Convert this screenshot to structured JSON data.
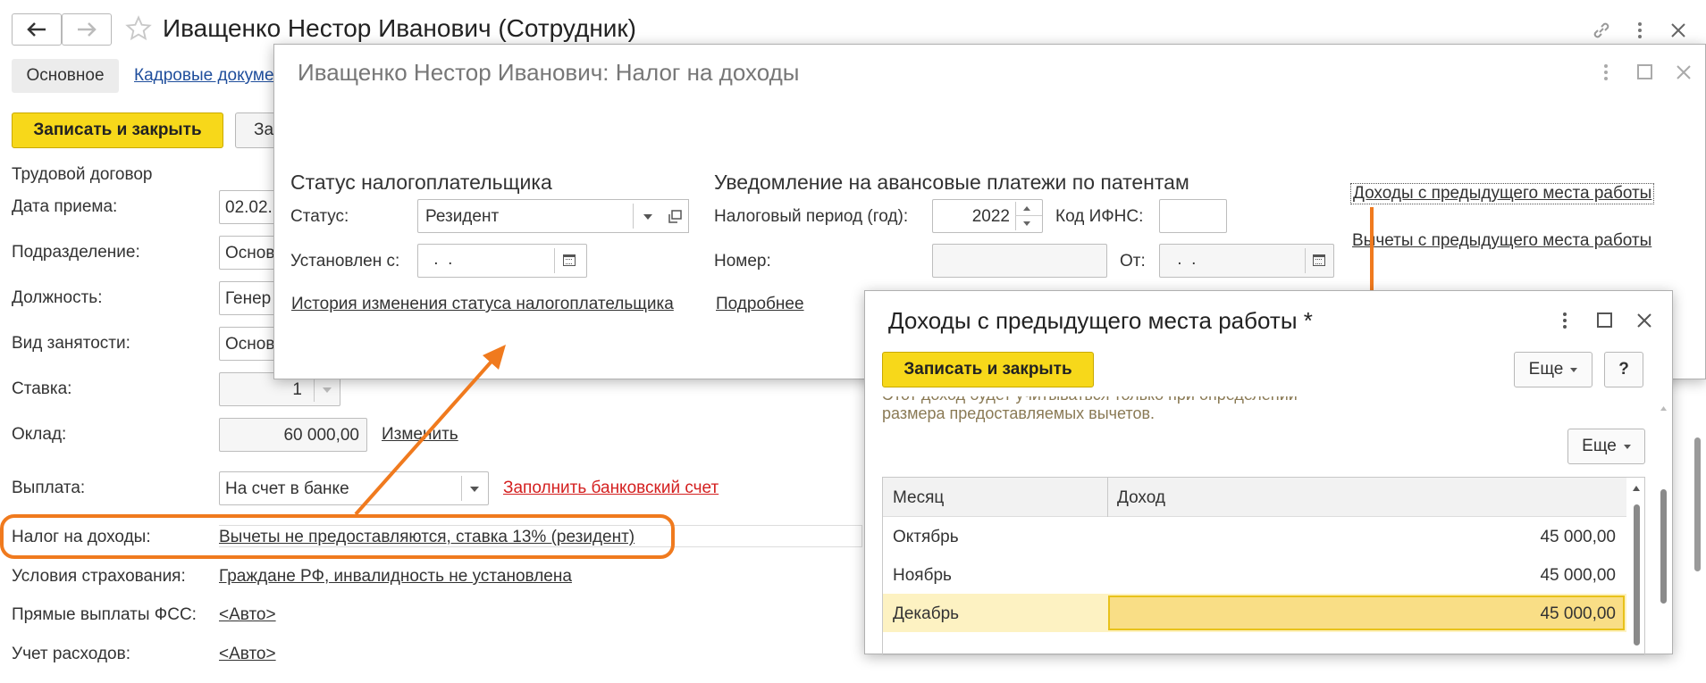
{
  "main": {
    "title": "Иващенко Нестор Иванович (Сотрудник)",
    "tabs": {
      "main_tab": "Основное",
      "hr_docs": "Кадровые докуме"
    },
    "save_close": "Записать и закрыть",
    "save_partial": "За",
    "section_contract": "Трудовой договор",
    "rows": {
      "hire_date": {
        "label": "Дата приема:",
        "value": "02.02."
      },
      "department": {
        "label": "Подразделение:",
        "value": "Основ"
      },
      "position": {
        "label": "Должность:",
        "value": "Генер"
      },
      "employment": {
        "label": "Вид занятости:",
        "value": "Основ"
      },
      "rate": {
        "label": "Ставка:",
        "value": "1"
      },
      "salary": {
        "label": "Оклад:",
        "value": "60 000,00",
        "link": "Изменить"
      },
      "payment": {
        "label": "Выплата:",
        "value": "На счет в банке",
        "link": "Заполнить банковский счет"
      },
      "income_tax": {
        "label": "Налог на доходы:",
        "link": "Вычеты не предоставляются, ставка 13% (резидент)"
      },
      "insurance": {
        "label": "Условия страхования:",
        "link": "Граждане РФ, инвалидность не установлена"
      },
      "fss": {
        "label": "Прямые выплаты ФСС:",
        "link": "<Авто>"
      },
      "expenses": {
        "label": "Учет расходов:",
        "link": "<Авто>"
      }
    }
  },
  "tax_window": {
    "title": "Иващенко Нестор Иванович: Налог на доходы",
    "status_section": "Статус налогоплательщика",
    "status_label": "Статус:",
    "status_value": "Резидент",
    "set_from_label": "Установлен с:",
    "set_from_value": " .  .",
    "history_link": "История изменения статуса налогоплательщика",
    "patent_section": "Уведомление на авансовые платежи по патентам",
    "period_label": "Налоговый период (год):",
    "period_value": "2022",
    "ifns_label": "Код ИФНС:",
    "number_label": "Номер:",
    "from_label": "От:",
    "from_value": " .  .",
    "more_link": "Подробнее",
    "prev_income_link": "Доходы с предыдущего места работы",
    "prev_deductions_link": "Вычеты с предыдущего места работы"
  },
  "income_window": {
    "title": "Доходы с предыдущего места работы *",
    "save_close": "Записать и закрыть",
    "more": "Еще",
    "help": "?",
    "note_line1": "Этот доход будет учитываться только при определении",
    "note_line2": "размера предоставляемых вычетов.",
    "table": {
      "headers": [
        "Месяц",
        "Доход"
      ],
      "rows": [
        {
          "month": "Октябрь",
          "income": "45 000,00"
        },
        {
          "month": "Ноябрь",
          "income": "45 000,00"
        },
        {
          "month": "Декабрь",
          "income": "45 000,00"
        }
      ]
    }
  },
  "colors": {
    "accent_yellow": "#f7d81a",
    "annotation_orange": "#f07a1e",
    "section_green": "#1a9a3a",
    "link_blue": "#1f4e9c"
  }
}
